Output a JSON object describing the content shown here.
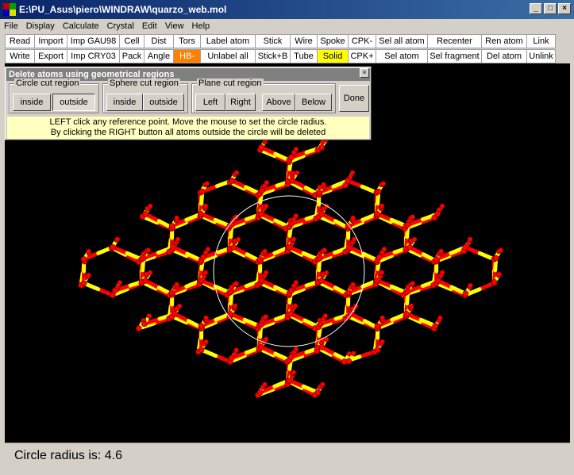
{
  "window": {
    "title": "E:\\PU_Asus\\piero\\WINDRAW\\quarzo_web.mol",
    "minimize": "_",
    "maximize": "□",
    "close": "×"
  },
  "menu": [
    "File",
    "Display",
    "Calculate",
    "Crystal",
    "Edit",
    "View",
    "Help"
  ],
  "toolbar": {
    "row1": [
      "Read",
      "Import",
      "Imp GAU98",
      "Cell",
      "Dist",
      "Tors",
      "Label atom",
      "Stick",
      "Wire",
      "Spoke",
      "CPK-",
      "Sel all atom",
      "Recenter",
      "Ren atom",
      "Link"
    ],
    "row2": [
      "Write",
      "Export",
      "Imp CRY03",
      "Pack",
      "Angle",
      "HB-",
      "Unlabel all",
      "Stick+B",
      "Tube",
      "Solid",
      "CPK+",
      "Sel atom",
      "Sel fragment",
      "Del atom",
      "Unlink"
    ],
    "highlight": {
      "HB-": "#ff8000",
      "Solid": "#ffff00"
    }
  },
  "dialog": {
    "title": "Delete atoms using geometrical regions",
    "close": "×",
    "groups": {
      "circle": {
        "label": "Circle  cut  region",
        "buttons": [
          "inside",
          "outside"
        ],
        "pressed": "outside"
      },
      "sphere": {
        "label": "Sphere  cut  region",
        "buttons": [
          "inside",
          "outside"
        ]
      },
      "plane": {
        "label": "Plane cut region",
        "buttons": [
          "Left",
          "Right",
          "Above",
          "Below"
        ]
      }
    },
    "done": "Done",
    "hint_line1": "LEFT click any reference point. Move the mouse to set the circle radius.",
    "hint_line2": "By clicking the RIGHT button all atoms outside the circle will be deleted"
  },
  "status": {
    "text": "Circle radius is: 4.6"
  },
  "colors": {
    "atom_oxygen": "#ff0000",
    "atom_silicon": "#ffff00",
    "background": "#000000",
    "circle": "#ffffff"
  }
}
